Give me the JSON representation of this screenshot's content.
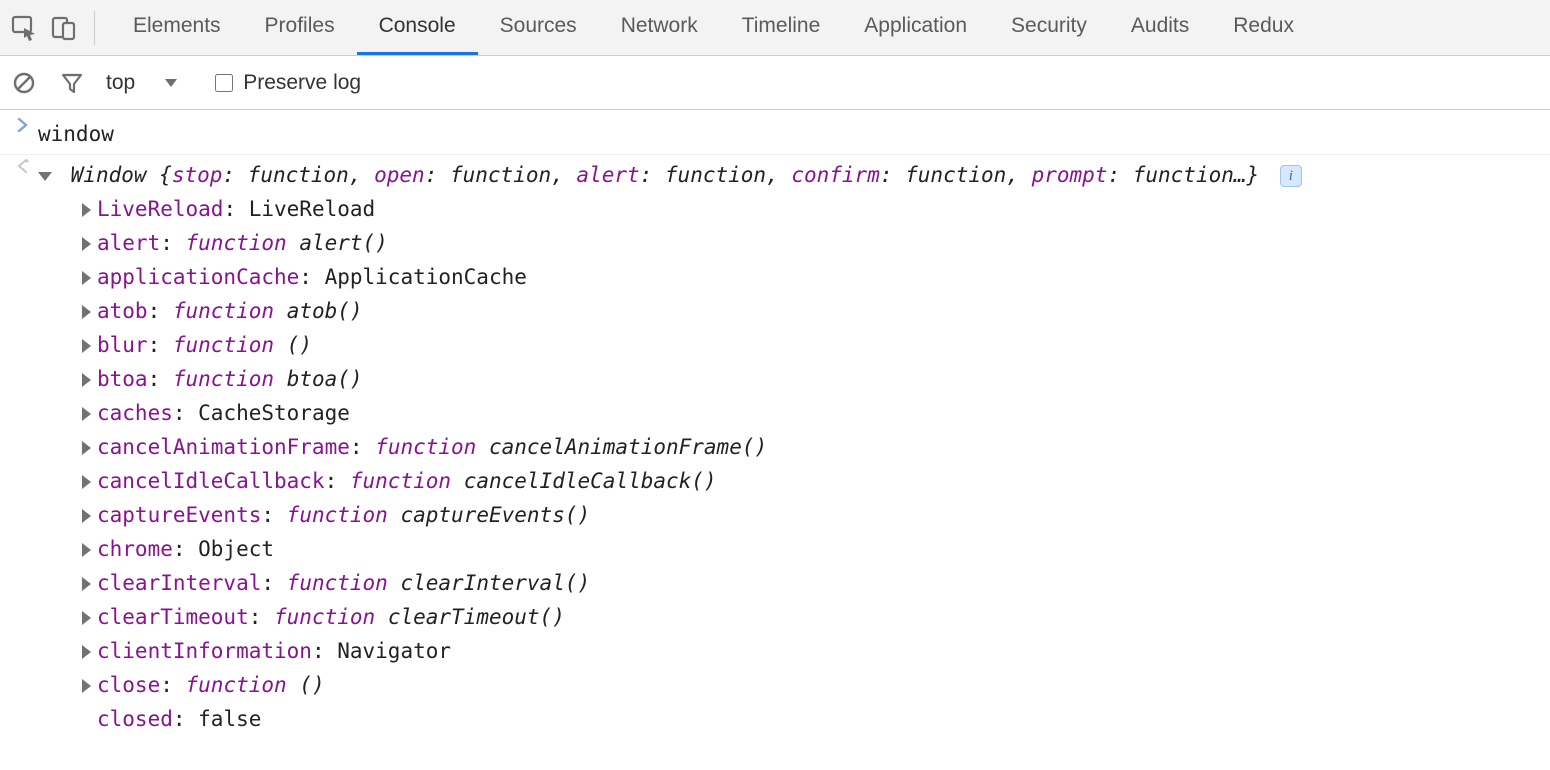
{
  "tabs": [
    "Elements",
    "Profiles",
    "Console",
    "Sources",
    "Network",
    "Timeline",
    "Application",
    "Security",
    "Audits",
    "Redux"
  ],
  "active_tab": "Console",
  "toolbar": {
    "context": "top",
    "preserve_log_label": "Preserve log"
  },
  "input_line": "window",
  "output_summary": {
    "class": "Window",
    "preview": [
      {
        "k": "stop",
        "v": "function"
      },
      {
        "k": "open",
        "v": "function"
      },
      {
        "k": "alert",
        "v": "function"
      },
      {
        "k": "confirm",
        "v": "function"
      },
      {
        "k": "prompt",
        "v": "function…"
      }
    ]
  },
  "properties": [
    {
      "k": "LiveReload",
      "type": "plain",
      "v": "LiveReload",
      "exp": true
    },
    {
      "k": "alert",
      "type": "func",
      "v": "function alert()",
      "exp": true
    },
    {
      "k": "applicationCache",
      "type": "plain",
      "v": "ApplicationCache",
      "exp": true
    },
    {
      "k": "atob",
      "type": "func",
      "v": "function atob()",
      "exp": true
    },
    {
      "k": "blur",
      "type": "func",
      "v": "function ()",
      "exp": true
    },
    {
      "k": "btoa",
      "type": "func",
      "v": "function btoa()",
      "exp": true
    },
    {
      "k": "caches",
      "type": "plain",
      "v": "CacheStorage",
      "exp": true
    },
    {
      "k": "cancelAnimationFrame",
      "type": "func",
      "v": "function cancelAnimationFrame()",
      "exp": true
    },
    {
      "k": "cancelIdleCallback",
      "type": "func",
      "v": "function cancelIdleCallback()",
      "exp": true
    },
    {
      "k": "captureEvents",
      "type": "func",
      "v": "function captureEvents()",
      "exp": true
    },
    {
      "k": "chrome",
      "type": "plain",
      "v": "Object",
      "exp": true
    },
    {
      "k": "clearInterval",
      "type": "func",
      "v": "function clearInterval()",
      "exp": true
    },
    {
      "k": "clearTimeout",
      "type": "func",
      "v": "function clearTimeout()",
      "exp": true
    },
    {
      "k": "clientInformation",
      "type": "plain",
      "v": "Navigator",
      "exp": true
    },
    {
      "k": "close",
      "type": "func",
      "v": "function ()",
      "exp": true
    },
    {
      "k": "closed",
      "type": "plain",
      "v": "false",
      "exp": false
    }
  ],
  "info_letter": "i"
}
